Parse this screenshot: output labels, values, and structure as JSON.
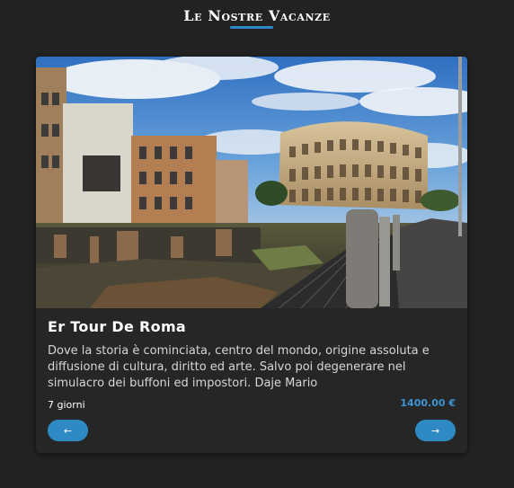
{
  "header": {
    "title": "Le Nostre Vacanze",
    "accent_color": "#2f86c6"
  },
  "card": {
    "image_alt": "Colosseum and Roman Forum ruins under a blue cloudy sky",
    "title": "Er Tour De Roma",
    "description": "Dove la storia è cominciata, centro del mondo, origine assoluta e diffusione di cultura, diritto ed arte. Salvo poi degenerare nel simulacro dei buffoni ed impostori. Daje Mario",
    "duration": "7 giorni",
    "price": "1400.00 €",
    "price_color": "#3c95d2"
  },
  "nav": {
    "prev_icon": "arrow-left-icon",
    "prev_glyph": "←",
    "next_icon": "arrow-right-icon",
    "next_glyph": "→",
    "button_color": "#2f8ac4"
  }
}
